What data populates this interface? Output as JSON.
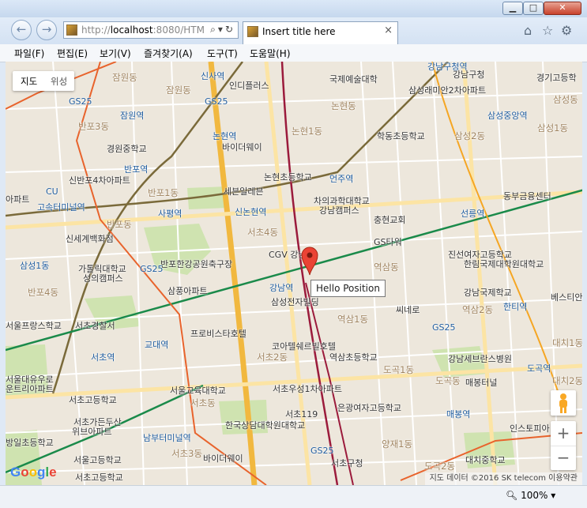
{
  "window": {
    "minimize_label": "▁",
    "maximize_label": "□",
    "close_label": "✕"
  },
  "nav": {
    "back_icon": "back-arrow-icon",
    "forward_icon": "forward-arrow-icon",
    "url_scheme": "http://",
    "url_host": "localhost",
    "url_rest": ":8080/HTM",
    "tab_title": "Insert title here",
    "tab_close": "×"
  },
  "menu": {
    "items": [
      "파일(F)",
      "편집(E)",
      "보기(V)",
      "즐겨찾기(A)",
      "도구(T)",
      "도움말(H)"
    ]
  },
  "map": {
    "type_options": [
      "지도",
      "위성"
    ],
    "info_text": "Hello Position",
    "attribution": "지도 데이터 ©2016 SK telecom    이용약관",
    "logo": "Google",
    "zoom_in": "+",
    "zoom_out": "−",
    "labels": {
      "l1": "잠원동",
      "l2": "잠원동",
      "l3": "신사역",
      "l4": "인디플러스",
      "l5": "국제예술대학",
      "l6": "강남구청역",
      "l7": "강남구청",
      "l8": "경기고등학",
      "l9": "삼성1동",
      "l10": "GS25",
      "l11": "GS25",
      "l12": "논현동",
      "l13": "삼성래미안2차아파트",
      "l14": "삼성동",
      "l15": "잠원역",
      "l16": "반포3동",
      "l17": "논현역",
      "l18": "논현1동",
      "l19": "학동초등학교",
      "l20": "삼성2동",
      "l21": "삼성중앙역",
      "l22": "삼성1동",
      "l23": "경원중학교",
      "l24": "바이더웨이",
      "l25": "반포역",
      "l26": "논현초등학교",
      "l27": "언주역",
      "l28": "신반포4차아파트",
      "l29": "CU",
      "l30": "세븐일레븐",
      "l31": "차의과학대학교",
      "l32": "강남캠퍼스",
      "l33": "동부금융센터",
      "l34": "아파트",
      "l35": "반포1동",
      "l36": "고속터미널역",
      "l37": "사평역",
      "l38": "신논현역",
      "l39": "충현교회",
      "l40": "선릉역",
      "l41": "반포동",
      "l42": "서초4동",
      "l43": "GS타워",
      "l44": "신세계백화점",
      "l45": "CGV 강남",
      "l46": "반포한강공원축구장",
      "l47": "역삼동",
      "l48": "진선여자고등학교",
      "l49": "가톨릭대학교",
      "l50": "성의캠퍼스",
      "l51": "GS25",
      "l52": "한림국제대학원대학교",
      "l53": "반포4동",
      "l54": "삼풍아파트",
      "l55": "강남역",
      "l56": "삼성전자빌딩",
      "l57": "강남국제학교",
      "l58": "씨네로",
      "l59": "한티역",
      "l60": "베스티안",
      "l61": "서울프랑스학교",
      "l62": "서초경찰서",
      "l63": "프로비스타호텔",
      "l64": "역삼1동",
      "l65": "GS25",
      "l66": "역삼2동",
      "l67": "교대역",
      "l68": "코아텔쉐르빌호텔",
      "l69": "서초역",
      "l70": "역삼초등학교",
      "l71": "대치1동",
      "l72": "대치2동",
      "l73": "서울대유우로",
      "l74": "운트리아파트",
      "l75": "서초2동",
      "l76": "도곡1동",
      "l77": "강남세브란스병원",
      "l78": "도곡역",
      "l79": "서울교육대학교",
      "l80": "서초우성1차아파트",
      "l81": "도곡동",
      "l82": "매봉터널",
      "l83": "서초고등학교",
      "l84": "서초동",
      "l85": "서초119",
      "l86": "은광여자고등학교",
      "l87": "서초가든두산",
      "l88": "위브아파트",
      "l89": "매봉역",
      "l90": "남부터미널역",
      "l91": "한국상담대학원대학교",
      "l92": "인스토피아",
      "l93": "방일초등학교",
      "l94": "서초3동",
      "l95": "서울고등학교",
      "l96": "바이더웨이",
      "l97": "GS25",
      "l98": "양재1동",
      "l99": "대치중학교",
      "l100": "도곡2동",
      "l101": "서초구청",
      "l102": "서초고등학교"
    }
  },
  "status": {
    "zoom": "100%"
  }
}
